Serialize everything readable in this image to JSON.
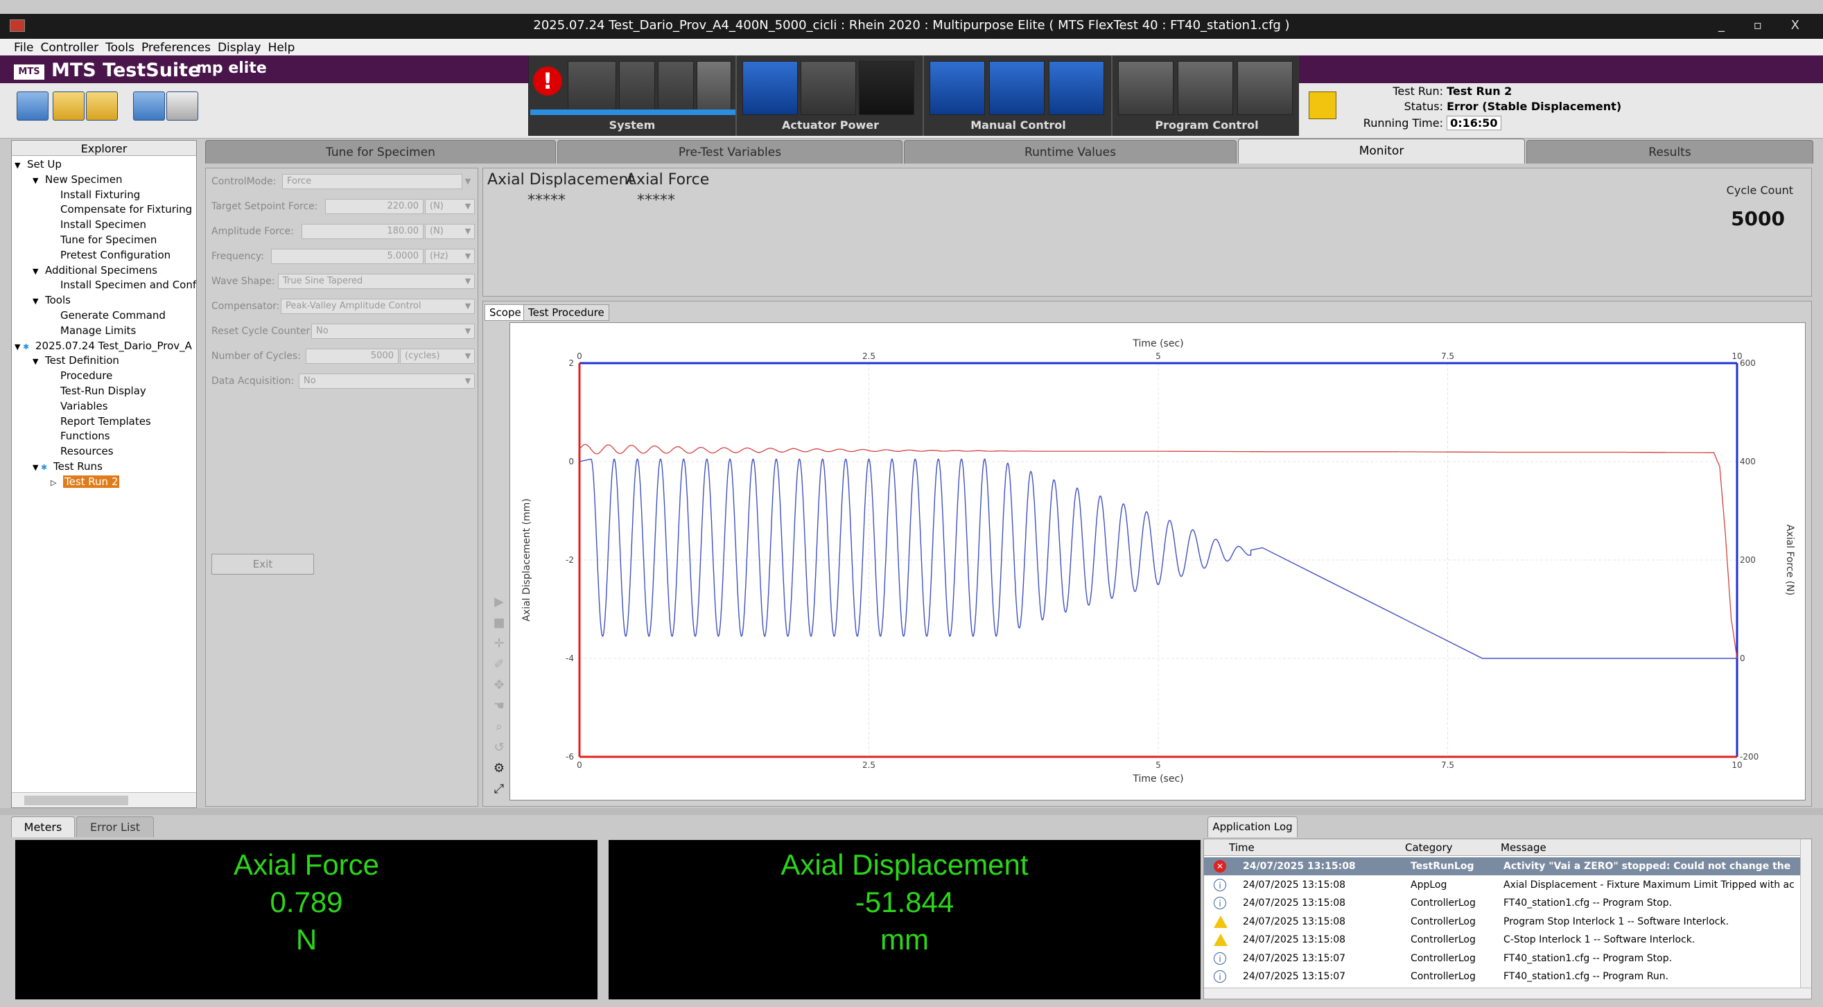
{
  "window": {
    "title": "2025.07.24 Test_Dario_Prov_A4_400N_5000_cicli : Rhein 2020 : Multipurpose Elite ( MTS FlexTest 40 : FT40_station1.cfg )",
    "controls": "_ ▫ X"
  },
  "menu": [
    "File",
    "Controller",
    "Tools",
    "Preferences",
    "Display",
    "Help"
  ],
  "brand": {
    "name": "MTS TestSuite",
    "logo": "MTS",
    "product": "mp elite"
  },
  "control_panel": {
    "system_label": "System",
    "actuator_label": "Actuator Power",
    "manual_label": "Manual Control",
    "program_label": "Program Control",
    "estop_glyph": "!"
  },
  "run_info": {
    "test_run_key": "Test Run:",
    "test_run_val": "Test Run 2",
    "status_key": "Status:",
    "status_val": "Error (Stable Displacement)",
    "time_key": "Running Time:",
    "time_val": "0:16:50"
  },
  "explorer": {
    "title": "Explorer",
    "items": [
      {
        "label": "Set Up",
        "indent": 0,
        "arrow": "▼"
      },
      {
        "label": "New Specimen",
        "indent": 1,
        "arrow": "▼"
      },
      {
        "label": "Install Fixturing",
        "indent": 2,
        "arrow": ""
      },
      {
        "label": "Compensate for Fixturing",
        "indent": 2,
        "arrow": ""
      },
      {
        "label": "Install Specimen",
        "indent": 2,
        "arrow": ""
      },
      {
        "label": "Tune for Specimen",
        "indent": 2,
        "arrow": ""
      },
      {
        "label": "Pretest Configuration",
        "indent": 2,
        "arrow": ""
      },
      {
        "label": "Additional Specimens",
        "indent": 1,
        "arrow": "▼"
      },
      {
        "label": "Install Specimen and Confi",
        "indent": 2,
        "arrow": ""
      },
      {
        "label": "Tools",
        "indent": 1,
        "arrow": "▼"
      },
      {
        "label": "Generate Command",
        "indent": 2,
        "arrow": ""
      },
      {
        "label": "Manage Limits",
        "indent": 2,
        "arrow": ""
      },
      {
        "label": "2025.07.24 Test_Dario_Prov_A",
        "indent": 0,
        "arrow": "▼ ✱"
      },
      {
        "label": "Test Definition",
        "indent": 1,
        "arrow": "▼"
      },
      {
        "label": "Procedure",
        "indent": 2,
        "arrow": ""
      },
      {
        "label": "Test-Run Display",
        "indent": 2,
        "arrow": ""
      },
      {
        "label": "Variables",
        "indent": 2,
        "arrow": ""
      },
      {
        "label": "Report Templates",
        "indent": 2,
        "arrow": ""
      },
      {
        "label": "Functions",
        "indent": 2,
        "arrow": ""
      },
      {
        "label": "Resources",
        "indent": 2,
        "arrow": ""
      },
      {
        "label": "Test Runs",
        "indent": 1,
        "arrow": "▼ ✱"
      },
      {
        "label": "Test Run 2",
        "indent": 2,
        "arrow": "▷",
        "selected": true
      }
    ]
  },
  "tabs": [
    "Tune for Specimen",
    "Pre-Test Variables",
    "Runtime Values",
    "Monitor",
    "Results"
  ],
  "active_tab": "Monitor",
  "params": {
    "control_mode": {
      "label": "ControlMode:",
      "value": "Force"
    },
    "target": {
      "label": "Target Setpoint Force:",
      "value": "220.00",
      "unit": "(N)"
    },
    "amplitude": {
      "label": "Amplitude Force:",
      "value": "180.00",
      "unit": "(N)"
    },
    "frequency": {
      "label": "Frequency:",
      "value": "5.0000",
      "unit": "(Hz)"
    },
    "wave": {
      "label": "Wave Shape:",
      "value": "True Sine Tapered"
    },
    "compensator": {
      "label": "Compensator:",
      "value": "Peak-Valley Amplitude Control"
    },
    "reset": {
      "label": "Reset Cycle Counter:",
      "value": "No"
    },
    "cycles": {
      "label": "Number of Cycles:",
      "value": "5000",
      "unit": "(cycles)"
    },
    "daq": {
      "label": "Data Acquisition:",
      "value": "No"
    },
    "exit": "Exit"
  },
  "monitor": {
    "disp_label": "Axial Displacement",
    "disp_value": "*****",
    "force_label": "Axial Force",
    "force_value": "*****",
    "cycle_label": "Cycle Count",
    "cycle_value": "5000"
  },
  "scope_tabs": [
    "Scope",
    "Test Procedure"
  ],
  "chart_data": {
    "type": "line",
    "title": "",
    "xlabel": "Time (sec)",
    "ylabel_left": "Axial Displacement (mm)",
    "ylabel_right": "Axial Force (N)",
    "xlim": [
      0,
      10
    ],
    "ylim_left": [
      -6,
      2
    ],
    "ylim_right": [
      -200,
      600
    ],
    "x_ticks": [
      "0",
      "2.5",
      "5",
      "7.5",
      "10"
    ],
    "y_left_ticks": [
      "2",
      "0",
      "-2",
      "-4",
      "-6"
    ],
    "y_right_ticks": [
      "600",
      "400",
      "200",
      "0",
      "-200"
    ],
    "grid": true,
    "series": [
      {
        "axis": "right",
        "color": "#d44040",
        "x": [
          0,
          0.5,
          1,
          2,
          3,
          4,
          5,
          6,
          7,
          8,
          9,
          9.8,
          9.85,
          9.9,
          9.95,
          10
        ],
        "y": [
          425,
          425,
          423,
          423,
          422,
          421,
          421,
          420,
          420,
          419,
          419,
          418,
          390,
          250,
          80,
          0
        ],
        "osc_amp": [
          10,
          8,
          6,
          3,
          1,
          0,
          0,
          0,
          0,
          0,
          0,
          0,
          0,
          0,
          0,
          0
        ]
      },
      {
        "axis": "left",
        "color": "#4050c0",
        "sine_start": 0.1,
        "sine_end": 5.8,
        "sine_hz": 5,
        "centre": [
          [
            0.1,
            -1.75
          ],
          [
            4.0,
            -1.75
          ],
          [
            5.0,
            -1.8
          ],
          [
            5.8,
            -1.85
          ]
        ],
        "amp": [
          [
            0.1,
            1.8
          ],
          [
            3.6,
            1.8
          ],
          [
            4.2,
            1.3
          ],
          [
            5.0,
            0.7
          ],
          [
            5.5,
            0.25
          ],
          [
            5.8,
            0.05
          ]
        ],
        "ramp": [
          [
            5.8,
            -1.8
          ],
          [
            5.9,
            -1.75
          ],
          [
            7.8,
            -4.0
          ],
          [
            10,
            -4.0
          ]
        ]
      }
    ]
  },
  "bottom_tabs": [
    "Meters",
    "Error List"
  ],
  "meters": [
    {
      "name": "Axial Force",
      "value": "0.789",
      "unit": "N"
    },
    {
      "name": "Axial Displacement",
      "value": "-51.844",
      "unit": "mm"
    }
  ],
  "log": {
    "tab": "Application Log",
    "columns": [
      "Time",
      "Category",
      "Message"
    ],
    "rows": [
      {
        "level": "err",
        "time": "24/07/2025 13:15:08",
        "category": "TestRunLog",
        "message": "Activity \"Vai a ZERO\" stopped: Could not change the setp"
      },
      {
        "level": "info",
        "time": "24/07/2025 13:15:08",
        "category": "AppLog",
        "message": "Axial Displacement - Fixture Maximum Limit Tripped with action C"
      },
      {
        "level": "info",
        "time": "24/07/2025 13:15:08",
        "category": "ControllerLog",
        "message": "FT40_station1.cfg -- Program Stop."
      },
      {
        "level": "warn",
        "time": "24/07/2025 13:15:08",
        "category": "ControllerLog",
        "message": "Program Stop Interlock 1 -- Software Interlock."
      },
      {
        "level": "warn",
        "time": "24/07/2025 13:15:08",
        "category": "ControllerLog",
        "message": "C-Stop Interlock 1 -- Software Interlock."
      },
      {
        "level": "info",
        "time": "24/07/2025 13:15:07",
        "category": "ControllerLog",
        "message": "FT40_station1.cfg -- Program Stop."
      },
      {
        "level": "info",
        "time": "24/07/2025 13:15:07",
        "category": "ControllerLog",
        "message": "FT40_station1.cfg -- Program Run."
      }
    ]
  }
}
